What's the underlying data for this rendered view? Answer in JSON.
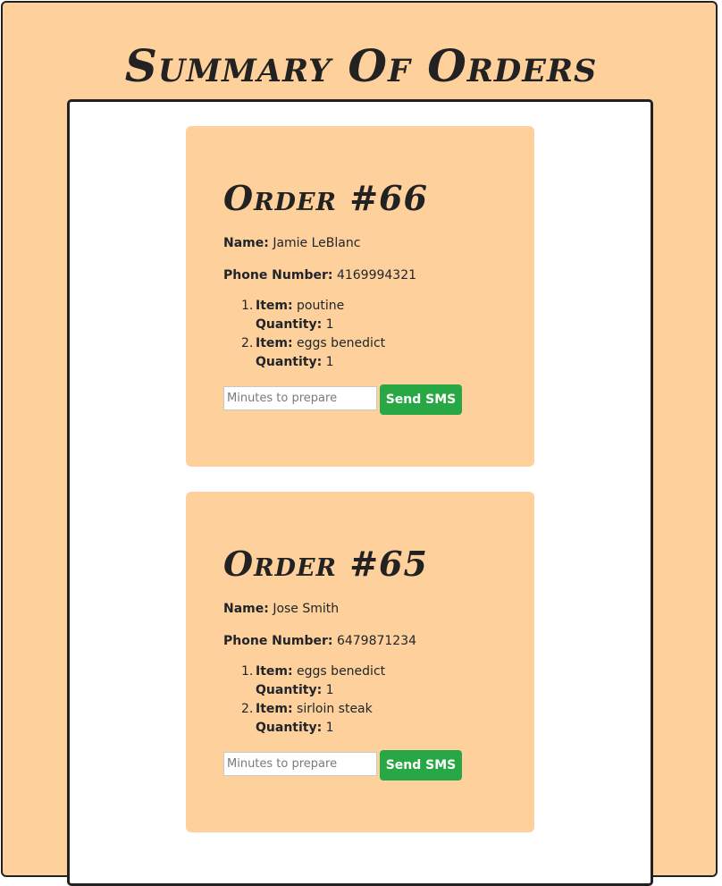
{
  "page": {
    "title": "Summary Of Orders"
  },
  "labels": {
    "name": "Name:",
    "phone": "Phone Number:",
    "item": "Item:",
    "quantity": "Quantity:"
  },
  "orders": [
    {
      "title": "Order #66",
      "name": "Jamie LeBlanc",
      "phone": "4169994321",
      "items": [
        {
          "num": "1.",
          "item": "poutine",
          "quantity": "1"
        },
        {
          "num": "2.",
          "item": "eggs benedict",
          "quantity": "1"
        }
      ],
      "input_placeholder": "Minutes to prepare",
      "button_label": "Send SMS"
    },
    {
      "title": "Order #65",
      "name": "Jose Smith",
      "phone": "6479871234",
      "items": [
        {
          "num": "1.",
          "item": "eggs benedict",
          "quantity": "1"
        },
        {
          "num": "2.",
          "item": "sirloin steak",
          "quantity": "1"
        }
      ],
      "input_placeholder": "Minutes to prepare",
      "button_label": "Send SMS"
    }
  ],
  "colors": {
    "page_background": "#fed09c",
    "card_background": "#fed09c",
    "panel_background": "#ffffff",
    "border": "#222222",
    "button": "#28a745",
    "button_text": "#ffffff"
  }
}
